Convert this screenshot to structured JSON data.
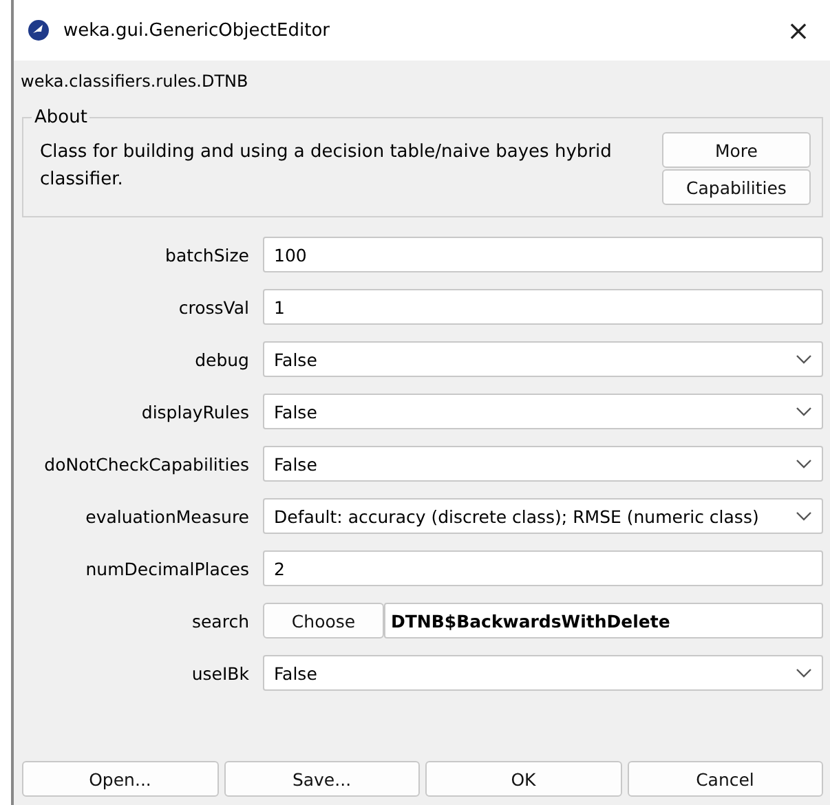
{
  "window": {
    "title": "weka.gui.GenericObjectEditor",
    "close": "×"
  },
  "class_name": "weka.classifiers.rules.DTNB",
  "about": {
    "legend": "About",
    "text": "Class for building and using a decision table/naive bayes hybrid classifier.",
    "buttons": [
      "More",
      "Capabilities"
    ]
  },
  "properties": [
    {
      "label": "batchSize",
      "kind": "text",
      "value": "100"
    },
    {
      "label": "crossVal",
      "kind": "text",
      "value": "1"
    },
    {
      "label": "debug",
      "kind": "dropdown",
      "value": "False"
    },
    {
      "label": "displayRules",
      "kind": "dropdown",
      "value": "False"
    },
    {
      "label": "doNotCheckCapabilities",
      "kind": "dropdown",
      "value": "False"
    },
    {
      "label": "evaluationMeasure",
      "kind": "dropdown",
      "value": "Default: accuracy (discrete class); RMSE (numeric class)"
    },
    {
      "label": "numDecimalPlaces",
      "kind": "text",
      "value": "2"
    },
    {
      "label": "search",
      "kind": "chooser",
      "button": "Choose",
      "value": "DTNB$BackwardsWithDelete"
    },
    {
      "label": "useIBk",
      "kind": "dropdown",
      "value": "False"
    }
  ],
  "buttons": [
    "Open...",
    "Save...",
    "OK",
    "Cancel"
  ]
}
